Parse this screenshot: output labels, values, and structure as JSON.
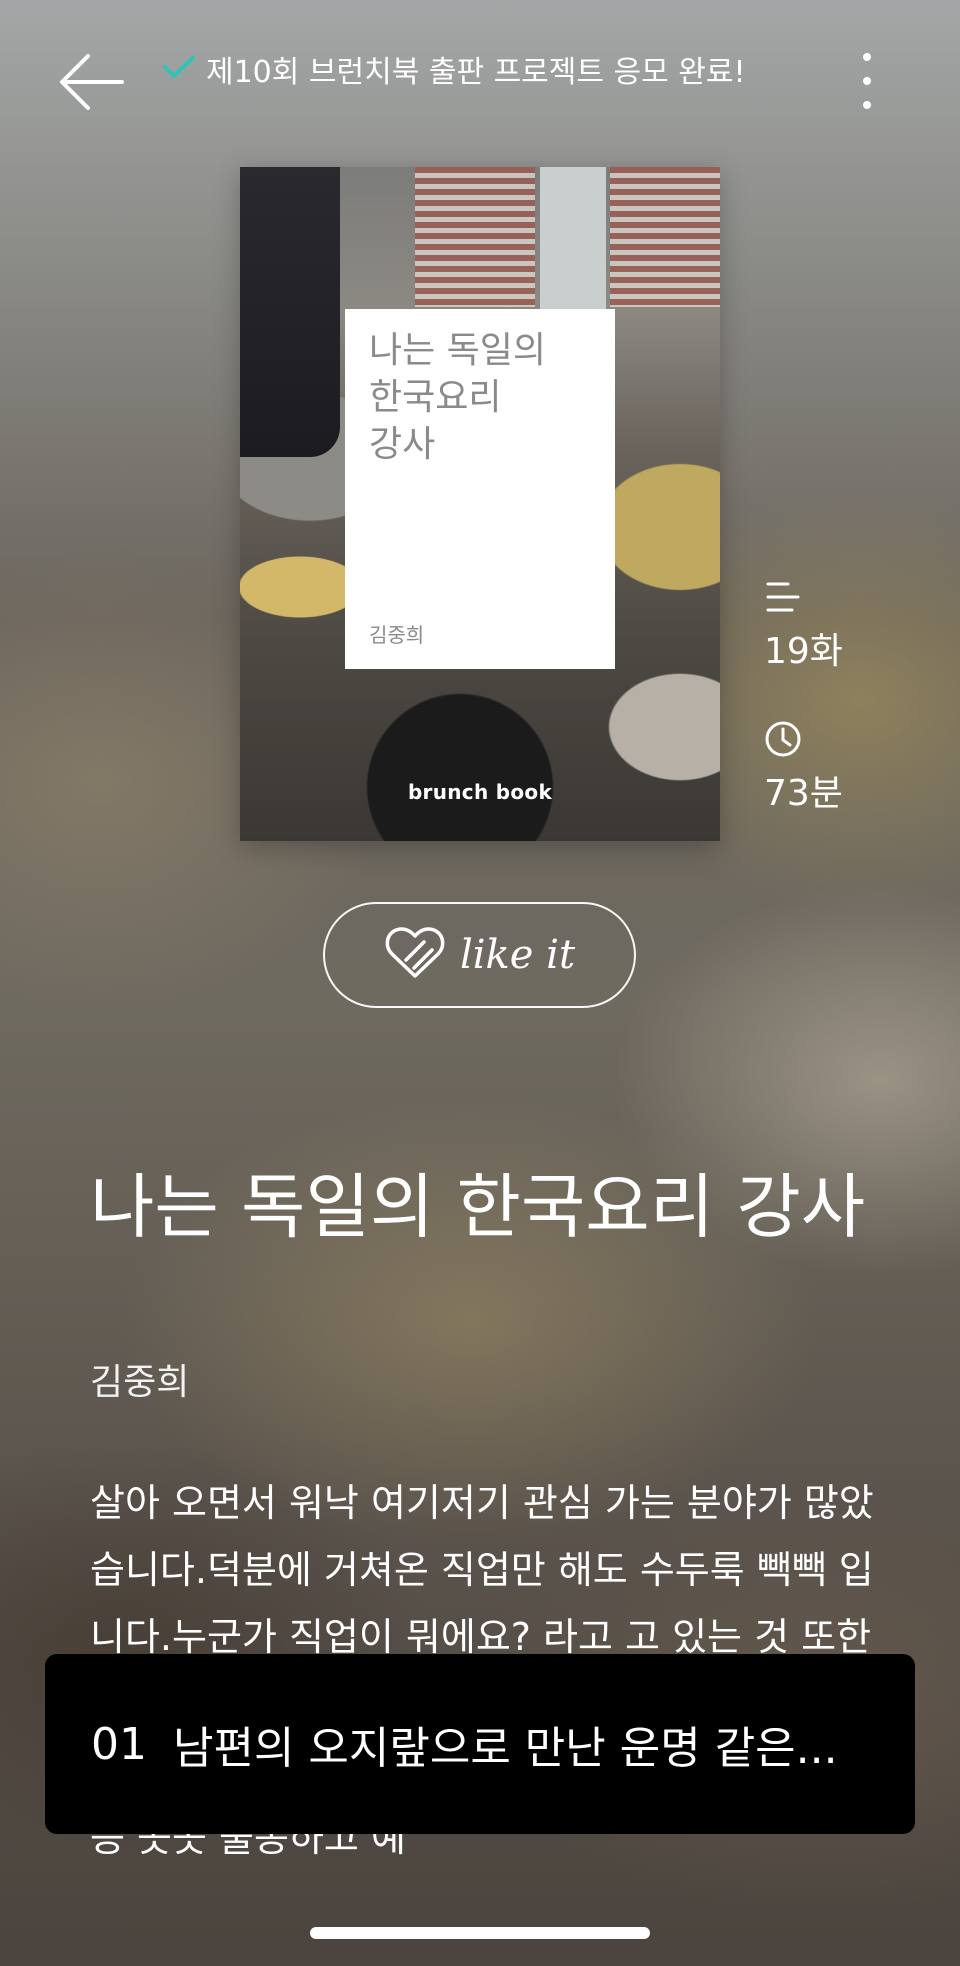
{
  "header": {
    "notice_text": "제10회 브런치북 출판 프로젝트 응모 완료!",
    "notice_icon": "check-icon",
    "accent_color": "#2ec4b6"
  },
  "cover": {
    "title": "나는 독일의\n한국요리\n강사",
    "author": "김중희",
    "brand": "brunch book"
  },
  "meta": {
    "episodes": "19화",
    "episodes_icon": "list-icon",
    "duration": "73분",
    "duration_icon": "clock-icon"
  },
  "like_button": {
    "label": "like it",
    "icon": "heart-icon"
  },
  "book": {
    "title": "나는 독일의 한국요리 강사",
    "author": "김중희",
    "description": "살아 오면서 워낙 여기저기 관심 가는 분야가 많았습니다.덕분에 거쳐온 직업만 해도 수두룩 빽빽 입니다.누군가 직업이 뭐에요? 라고 고 있는 것 또한 적지 않습니다.그중에서 가장 오래 열심히 하고 있는 것이 한국요리 강사 입니다. 독일의 문화센터 등 곳곳 출동하고 예"
  },
  "chapter": {
    "number": "01",
    "title": "남편의 오지랖으로 만난 운명 같은..."
  }
}
